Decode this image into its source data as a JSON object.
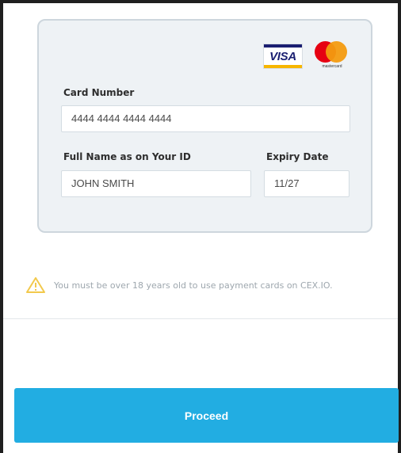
{
  "payment_card": {
    "brands": {
      "visa_text": "VISA",
      "mastercard_text": "mastercard"
    },
    "card_number": {
      "label": "Card Number",
      "value": "4444 4444 4444 4444"
    },
    "full_name": {
      "label": "Full Name as on Your ID",
      "value": "JOHN SMITH"
    },
    "expiry": {
      "label": "Expiry Date",
      "value": "11/27"
    }
  },
  "warning": {
    "icon": "warning-triangle-icon",
    "text": "You must be over 18 years old to use payment cards on CEX.IO."
  },
  "actions": {
    "proceed_label": "Proceed"
  },
  "colors": {
    "primary_button": "#22ade2",
    "panel_background": "#eef2f5",
    "warning_icon": "#f2c94c",
    "visa_blue": "#1a1f71",
    "mastercard_red": "#e60012",
    "mastercard_yellow": "#f39b10"
  }
}
